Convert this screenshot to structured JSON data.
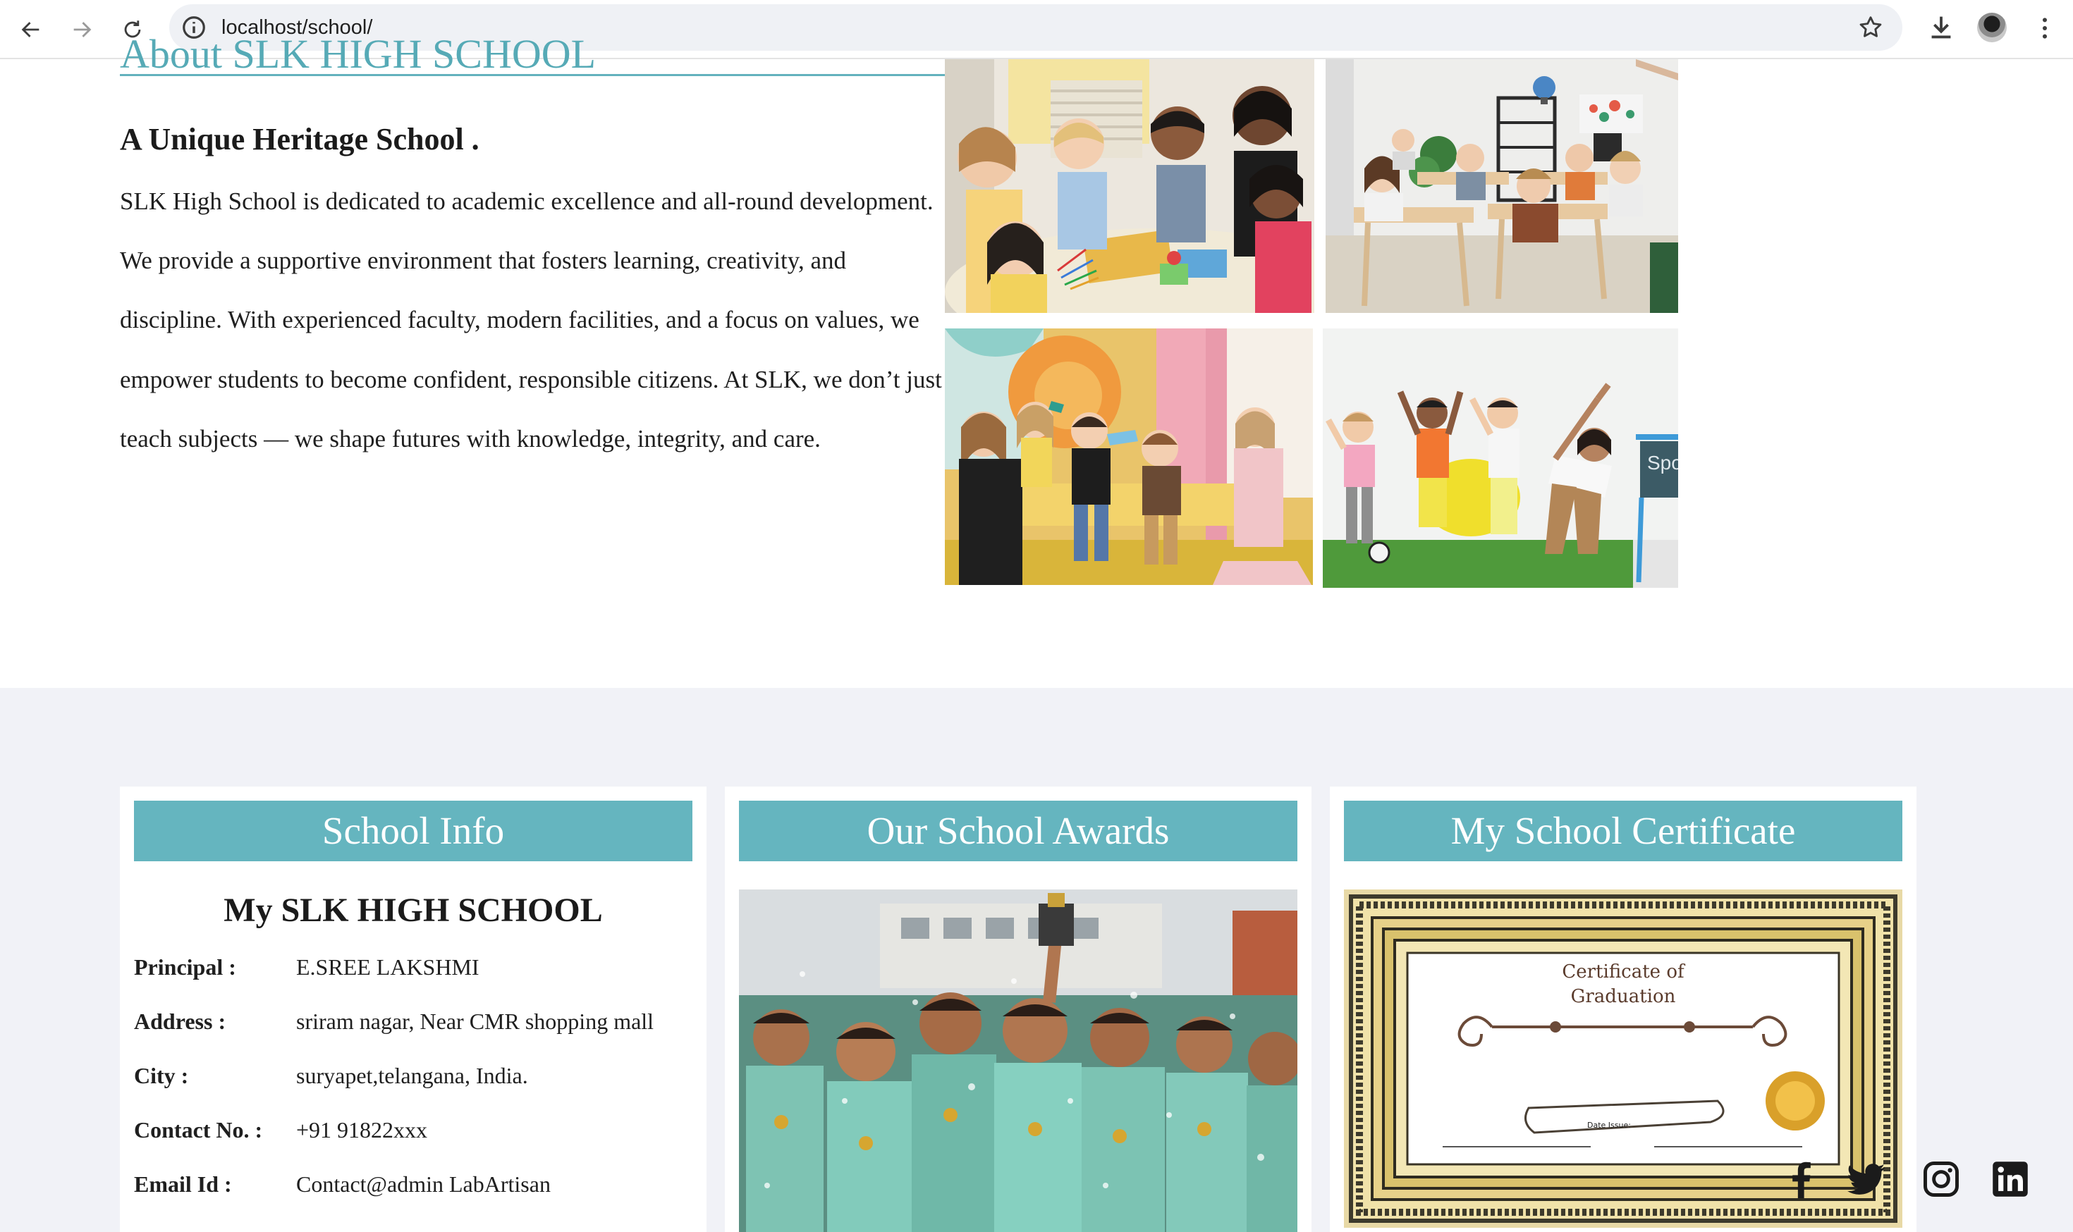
{
  "browser": {
    "url": "localhost/school/"
  },
  "about": {
    "heading": "About SLK HIGH SCHOOL",
    "subtitle": "A Unique Heritage School .",
    "paragraph": "SLK High School is dedicated to academic excellence and all-round development. We provide a supportive environment that fosters learning, creativity, and discipline. With experienced faculty, modern facilities, and a focus on values, we empower students to become confident, responsible citizens. At SLK, we don’t just teach subjects — we shape futures with knowledge, integrity, and care.",
    "photos": [
      "kids-crafting-photo",
      "classroom-photo",
      "kids-playing-photo",
      "kids-exercising-photo"
    ]
  },
  "school_info": {
    "header": "School Info",
    "name": "My SLK HIGH SCHOOL",
    "rows": [
      {
        "label": "Principal :",
        "value": "E.SREE LAKSHMI"
      },
      {
        "label": "Address :",
        "value": "sriram nagar, Near CMR shopping mall"
      },
      {
        "label": "City :",
        "value": "suryapet,telangana, India."
      },
      {
        "label": "Contact No. :",
        "value": "+91 91822xxx"
      },
      {
        "label": "Email Id :",
        "value": "Contact@admin LabArtisan"
      }
    ]
  },
  "awards": {
    "header": "Our School Awards"
  },
  "certificate": {
    "header": "My School Certificate",
    "title_line1": "Certificate of",
    "title_line2": "Graduation",
    "date_label": "Date Issue:"
  },
  "social": [
    "facebook-icon",
    "twitter-icon",
    "instagram-icon",
    "linkedin-icon"
  ],
  "colors": {
    "accent": "#65b5bf",
    "heading_teal": "#56aab6",
    "band_bg": "#f1f2f7"
  }
}
